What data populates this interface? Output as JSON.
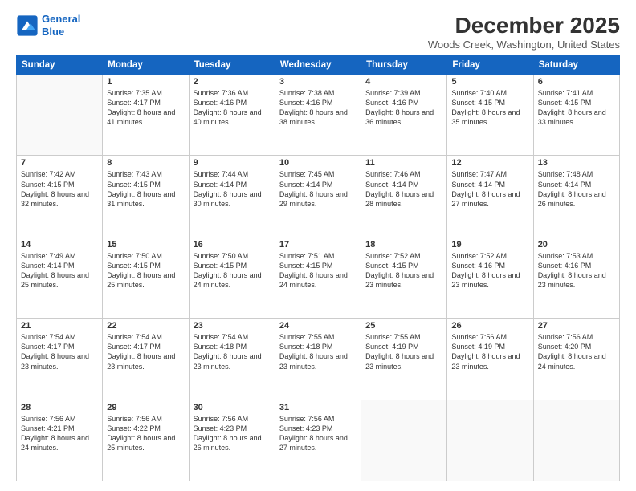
{
  "logo": {
    "line1": "General",
    "line2": "Blue"
  },
  "title": "December 2025",
  "location": "Woods Creek, Washington, United States",
  "header_days": [
    "Sunday",
    "Monday",
    "Tuesday",
    "Wednesday",
    "Thursday",
    "Friday",
    "Saturday"
  ],
  "weeks": [
    [
      {
        "day": "",
        "sunrise": "",
        "sunset": "",
        "daylight": ""
      },
      {
        "day": "1",
        "sunrise": "Sunrise: 7:35 AM",
        "sunset": "Sunset: 4:17 PM",
        "daylight": "Daylight: 8 hours and 41 minutes."
      },
      {
        "day": "2",
        "sunrise": "Sunrise: 7:36 AM",
        "sunset": "Sunset: 4:16 PM",
        "daylight": "Daylight: 8 hours and 40 minutes."
      },
      {
        "day": "3",
        "sunrise": "Sunrise: 7:38 AM",
        "sunset": "Sunset: 4:16 PM",
        "daylight": "Daylight: 8 hours and 38 minutes."
      },
      {
        "day": "4",
        "sunrise": "Sunrise: 7:39 AM",
        "sunset": "Sunset: 4:16 PM",
        "daylight": "Daylight: 8 hours and 36 minutes."
      },
      {
        "day": "5",
        "sunrise": "Sunrise: 7:40 AM",
        "sunset": "Sunset: 4:15 PM",
        "daylight": "Daylight: 8 hours and 35 minutes."
      },
      {
        "day": "6",
        "sunrise": "Sunrise: 7:41 AM",
        "sunset": "Sunset: 4:15 PM",
        "daylight": "Daylight: 8 hours and 33 minutes."
      }
    ],
    [
      {
        "day": "7",
        "sunrise": "Sunrise: 7:42 AM",
        "sunset": "Sunset: 4:15 PM",
        "daylight": "Daylight: 8 hours and 32 minutes."
      },
      {
        "day": "8",
        "sunrise": "Sunrise: 7:43 AM",
        "sunset": "Sunset: 4:15 PM",
        "daylight": "Daylight: 8 hours and 31 minutes."
      },
      {
        "day": "9",
        "sunrise": "Sunrise: 7:44 AM",
        "sunset": "Sunset: 4:14 PM",
        "daylight": "Daylight: 8 hours and 30 minutes."
      },
      {
        "day": "10",
        "sunrise": "Sunrise: 7:45 AM",
        "sunset": "Sunset: 4:14 PM",
        "daylight": "Daylight: 8 hours and 29 minutes."
      },
      {
        "day": "11",
        "sunrise": "Sunrise: 7:46 AM",
        "sunset": "Sunset: 4:14 PM",
        "daylight": "Daylight: 8 hours and 28 minutes."
      },
      {
        "day": "12",
        "sunrise": "Sunrise: 7:47 AM",
        "sunset": "Sunset: 4:14 PM",
        "daylight": "Daylight: 8 hours and 27 minutes."
      },
      {
        "day": "13",
        "sunrise": "Sunrise: 7:48 AM",
        "sunset": "Sunset: 4:14 PM",
        "daylight": "Daylight: 8 hours and 26 minutes."
      }
    ],
    [
      {
        "day": "14",
        "sunrise": "Sunrise: 7:49 AM",
        "sunset": "Sunset: 4:14 PM",
        "daylight": "Daylight: 8 hours and 25 minutes."
      },
      {
        "day": "15",
        "sunrise": "Sunrise: 7:50 AM",
        "sunset": "Sunset: 4:15 PM",
        "daylight": "Daylight: 8 hours and 25 minutes."
      },
      {
        "day": "16",
        "sunrise": "Sunrise: 7:50 AM",
        "sunset": "Sunset: 4:15 PM",
        "daylight": "Daylight: 8 hours and 24 minutes."
      },
      {
        "day": "17",
        "sunrise": "Sunrise: 7:51 AM",
        "sunset": "Sunset: 4:15 PM",
        "daylight": "Daylight: 8 hours and 24 minutes."
      },
      {
        "day": "18",
        "sunrise": "Sunrise: 7:52 AM",
        "sunset": "Sunset: 4:15 PM",
        "daylight": "Daylight: 8 hours and 23 minutes."
      },
      {
        "day": "19",
        "sunrise": "Sunrise: 7:52 AM",
        "sunset": "Sunset: 4:16 PM",
        "daylight": "Daylight: 8 hours and 23 minutes."
      },
      {
        "day": "20",
        "sunrise": "Sunrise: 7:53 AM",
        "sunset": "Sunset: 4:16 PM",
        "daylight": "Daylight: 8 hours and 23 minutes."
      }
    ],
    [
      {
        "day": "21",
        "sunrise": "Sunrise: 7:54 AM",
        "sunset": "Sunset: 4:17 PM",
        "daylight": "Daylight: 8 hours and 23 minutes."
      },
      {
        "day": "22",
        "sunrise": "Sunrise: 7:54 AM",
        "sunset": "Sunset: 4:17 PM",
        "daylight": "Daylight: 8 hours and 23 minutes."
      },
      {
        "day": "23",
        "sunrise": "Sunrise: 7:54 AM",
        "sunset": "Sunset: 4:18 PM",
        "daylight": "Daylight: 8 hours and 23 minutes."
      },
      {
        "day": "24",
        "sunrise": "Sunrise: 7:55 AM",
        "sunset": "Sunset: 4:18 PM",
        "daylight": "Daylight: 8 hours and 23 minutes."
      },
      {
        "day": "25",
        "sunrise": "Sunrise: 7:55 AM",
        "sunset": "Sunset: 4:19 PM",
        "daylight": "Daylight: 8 hours and 23 minutes."
      },
      {
        "day": "26",
        "sunrise": "Sunrise: 7:56 AM",
        "sunset": "Sunset: 4:19 PM",
        "daylight": "Daylight: 8 hours and 23 minutes."
      },
      {
        "day": "27",
        "sunrise": "Sunrise: 7:56 AM",
        "sunset": "Sunset: 4:20 PM",
        "daylight": "Daylight: 8 hours and 24 minutes."
      }
    ],
    [
      {
        "day": "28",
        "sunrise": "Sunrise: 7:56 AM",
        "sunset": "Sunset: 4:21 PM",
        "daylight": "Daylight: 8 hours and 24 minutes."
      },
      {
        "day": "29",
        "sunrise": "Sunrise: 7:56 AM",
        "sunset": "Sunset: 4:22 PM",
        "daylight": "Daylight: 8 hours and 25 minutes."
      },
      {
        "day": "30",
        "sunrise": "Sunrise: 7:56 AM",
        "sunset": "Sunset: 4:23 PM",
        "daylight": "Daylight: 8 hours and 26 minutes."
      },
      {
        "day": "31",
        "sunrise": "Sunrise: 7:56 AM",
        "sunset": "Sunset: 4:23 PM",
        "daylight": "Daylight: 8 hours and 27 minutes."
      },
      {
        "day": "",
        "sunrise": "",
        "sunset": "",
        "daylight": ""
      },
      {
        "day": "",
        "sunrise": "",
        "sunset": "",
        "daylight": ""
      },
      {
        "day": "",
        "sunrise": "",
        "sunset": "",
        "daylight": ""
      }
    ]
  ]
}
